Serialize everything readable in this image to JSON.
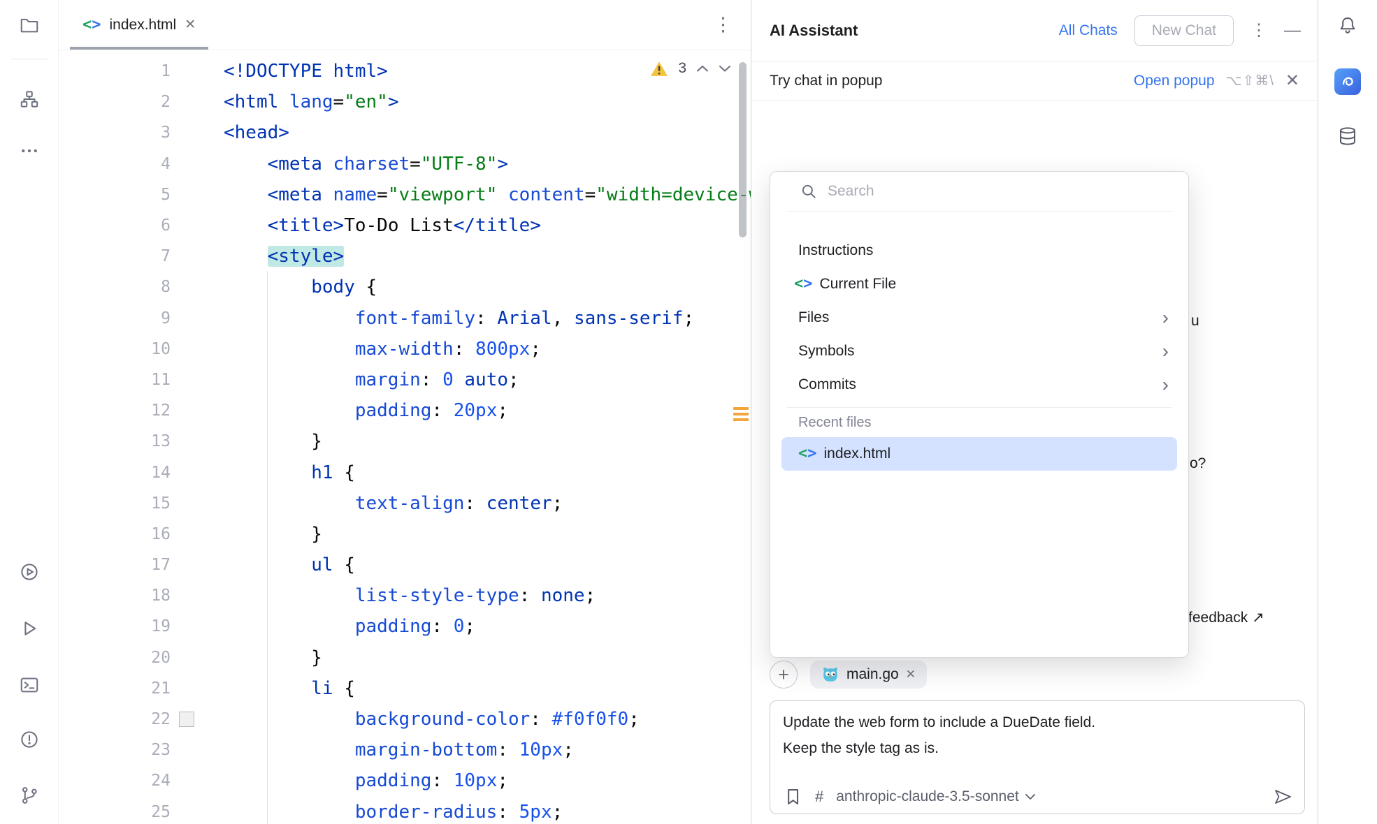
{
  "colors": {
    "accent": "#3574F0",
    "selection_bg": "#D4E2FF",
    "tag_highlight": "#C0E8E4",
    "warning_stripe": "#F2A63C",
    "swatch_value": "#f0f0f0"
  },
  "glyphs": {
    "kebab": "⋮",
    "minimize": "—",
    "close": "✕",
    "plus": "+",
    "chevron_right": "›",
    "hash": "#"
  },
  "left_toolbar": {
    "icons": [
      "folder",
      "structure",
      "more",
      "services",
      "run",
      "terminal",
      "problems",
      "version-control"
    ]
  },
  "right_toolbar": {
    "icons": [
      "notifications",
      "ai-assistant",
      "database"
    ]
  },
  "editor": {
    "tab": {
      "label": "index.html"
    },
    "warning_count": "3",
    "lines": [
      {
        "n": "1",
        "s": [
          {
            "t": "<!DOCTYPE html>",
            "c": "tag"
          }
        ]
      },
      {
        "n": "2",
        "s": [
          {
            "t": "<html ",
            "c": "tag"
          },
          {
            "t": "lang",
            "c": "attr"
          },
          {
            "t": "=",
            "c": "pln"
          },
          {
            "t": "\"en\"",
            "c": "str"
          },
          {
            "t": ">",
            "c": "tag"
          }
        ]
      },
      {
        "n": "3",
        "s": [
          {
            "t": "<head>",
            "c": "tag"
          }
        ]
      },
      {
        "n": "4",
        "s": [
          {
            "t": "    ",
            "c": "pln"
          },
          {
            "t": "<meta ",
            "c": "tag"
          },
          {
            "t": "charset",
            "c": "attr"
          },
          {
            "t": "=",
            "c": "pln"
          },
          {
            "t": "\"UTF-8\"",
            "c": "str"
          },
          {
            "t": ">",
            "c": "tag"
          }
        ]
      },
      {
        "n": "5",
        "s": [
          {
            "t": "    ",
            "c": "pln"
          },
          {
            "t": "<meta ",
            "c": "tag"
          },
          {
            "t": "name",
            "c": "attr"
          },
          {
            "t": "=",
            "c": "pln"
          },
          {
            "t": "\"viewport\"",
            "c": "str"
          },
          {
            "t": " ",
            "c": "pln"
          },
          {
            "t": "content",
            "c": "attr"
          },
          {
            "t": "=",
            "c": "pln"
          },
          {
            "t": "\"width=device-width,",
            "c": "str"
          }
        ]
      },
      {
        "n": "6",
        "s": [
          {
            "t": "    ",
            "c": "pln"
          },
          {
            "t": "<title>",
            "c": "tag"
          },
          {
            "t": "To-Do List",
            "c": "pln"
          },
          {
            "t": "</title>",
            "c": "tag"
          }
        ]
      },
      {
        "n": "7",
        "s": [
          {
            "t": "    ",
            "c": "pln"
          },
          {
            "t": "<style>",
            "c": "tag hl"
          }
        ]
      },
      {
        "n": "8",
        "s": [
          {
            "t": "        ",
            "c": "pln"
          },
          {
            "t": "body ",
            "c": "sel"
          },
          {
            "t": "{",
            "c": "pln"
          }
        ]
      },
      {
        "n": "9",
        "s": [
          {
            "t": "            ",
            "c": "pln"
          },
          {
            "t": "font-family",
            "c": "prop"
          },
          {
            "t": ": ",
            "c": "pln"
          },
          {
            "t": "Arial",
            "c": "val"
          },
          {
            "t": ", ",
            "c": "pln"
          },
          {
            "t": "sans-serif",
            "c": "val"
          },
          {
            "t": ";",
            "c": "pln"
          }
        ]
      },
      {
        "n": "10",
        "s": [
          {
            "t": "            ",
            "c": "pln"
          },
          {
            "t": "max-width",
            "c": "prop"
          },
          {
            "t": ": ",
            "c": "pln"
          },
          {
            "t": "800px",
            "c": "num"
          },
          {
            "t": ";",
            "c": "pln"
          }
        ]
      },
      {
        "n": "11",
        "s": [
          {
            "t": "            ",
            "c": "pln"
          },
          {
            "t": "margin",
            "c": "prop"
          },
          {
            "t": ": ",
            "c": "pln"
          },
          {
            "t": "0",
            "c": "num"
          },
          {
            "t": " ",
            "c": "pln"
          },
          {
            "t": "auto",
            "c": "val"
          },
          {
            "t": ";",
            "c": "pln"
          }
        ]
      },
      {
        "n": "12",
        "s": [
          {
            "t": "            ",
            "c": "pln"
          },
          {
            "t": "padding",
            "c": "prop"
          },
          {
            "t": ": ",
            "c": "pln"
          },
          {
            "t": "20px",
            "c": "num"
          },
          {
            "t": ";",
            "c": "pln"
          }
        ]
      },
      {
        "n": "13",
        "s": [
          {
            "t": "        }",
            "c": "pln"
          }
        ]
      },
      {
        "n": "14",
        "s": [
          {
            "t": "        ",
            "c": "pln"
          },
          {
            "t": "h1 ",
            "c": "sel"
          },
          {
            "t": "{",
            "c": "pln"
          }
        ]
      },
      {
        "n": "15",
        "s": [
          {
            "t": "            ",
            "c": "pln"
          },
          {
            "t": "text-align",
            "c": "prop"
          },
          {
            "t": ": ",
            "c": "pln"
          },
          {
            "t": "center",
            "c": "val"
          },
          {
            "t": ";",
            "c": "pln"
          }
        ]
      },
      {
        "n": "16",
        "s": [
          {
            "t": "        }",
            "c": "pln"
          }
        ]
      },
      {
        "n": "17",
        "s": [
          {
            "t": "        ",
            "c": "pln"
          },
          {
            "t": "ul ",
            "c": "sel"
          },
          {
            "t": "{",
            "c": "pln"
          }
        ]
      },
      {
        "n": "18",
        "s": [
          {
            "t": "            ",
            "c": "pln"
          },
          {
            "t": "list-style-type",
            "c": "prop"
          },
          {
            "t": ": ",
            "c": "pln"
          },
          {
            "t": "none",
            "c": "val"
          },
          {
            "t": ";",
            "c": "pln"
          }
        ]
      },
      {
        "n": "19",
        "s": [
          {
            "t": "            ",
            "c": "pln"
          },
          {
            "t": "padding",
            "c": "prop"
          },
          {
            "t": ": ",
            "c": "pln"
          },
          {
            "t": "0",
            "c": "num"
          },
          {
            "t": ";",
            "c": "pln"
          }
        ]
      },
      {
        "n": "20",
        "s": [
          {
            "t": "        }",
            "c": "pln"
          }
        ]
      },
      {
        "n": "21",
        "s": [
          {
            "t": "        ",
            "c": "pln"
          },
          {
            "t": "li ",
            "c": "sel"
          },
          {
            "t": "{",
            "c": "pln"
          }
        ]
      },
      {
        "n": "22",
        "swatch": "#f0f0f0",
        "s": [
          {
            "t": "            ",
            "c": "pln"
          },
          {
            "t": "background-color",
            "c": "prop"
          },
          {
            "t": ": ",
            "c": "pln"
          },
          {
            "t": "#f0f0f0",
            "c": "num"
          },
          {
            "t": ";",
            "c": "pln"
          }
        ]
      },
      {
        "n": "23",
        "s": [
          {
            "t": "            ",
            "c": "pln"
          },
          {
            "t": "margin-bottom",
            "c": "prop"
          },
          {
            "t": ": ",
            "c": "pln"
          },
          {
            "t": "10px",
            "c": "num"
          },
          {
            "t": ";",
            "c": "pln"
          }
        ]
      },
      {
        "n": "24",
        "s": [
          {
            "t": "            ",
            "c": "pln"
          },
          {
            "t": "padding",
            "c": "prop"
          },
          {
            "t": ": ",
            "c": "pln"
          },
          {
            "t": "10px",
            "c": "num"
          },
          {
            "t": ";",
            "c": "pln"
          }
        ]
      },
      {
        "n": "25",
        "s": [
          {
            "t": "            ",
            "c": "pln"
          },
          {
            "t": "border-radius",
            "c": "prop"
          },
          {
            "t": ": ",
            "c": "pln"
          },
          {
            "t": "5px",
            "c": "num"
          },
          {
            "t": ";",
            "c": "pln"
          }
        ]
      }
    ]
  },
  "ai_panel": {
    "header": {
      "title": "AI Assistant",
      "all_chats": "All Chats",
      "new_chat": "New Chat"
    },
    "banner": {
      "text": "Try chat in popup",
      "action": "Open popup",
      "shortcut": "⌥⇧⌘\\"
    },
    "fragments": [
      "u",
      "o?",
      "feedback ↗"
    ],
    "popup": {
      "search_placeholder": "Search",
      "items": [
        {
          "label": "Instructions"
        },
        {
          "label": "Current File",
          "icon": "code"
        },
        {
          "label": "Files",
          "chevron": true
        },
        {
          "label": "Symbols",
          "chevron": true
        },
        {
          "label": "Commits",
          "chevron": true
        }
      ],
      "section_label": "Recent files",
      "recent_files": [
        {
          "label": "index.html",
          "icon": "code",
          "selected": true
        }
      ]
    },
    "composer": {
      "chip": "main.go",
      "message_line1": "Update the web form to include a DueDate field.",
      "message_line2": " Keep the style tag as is.",
      "model": "anthropic-claude-3.5-sonnet"
    }
  }
}
